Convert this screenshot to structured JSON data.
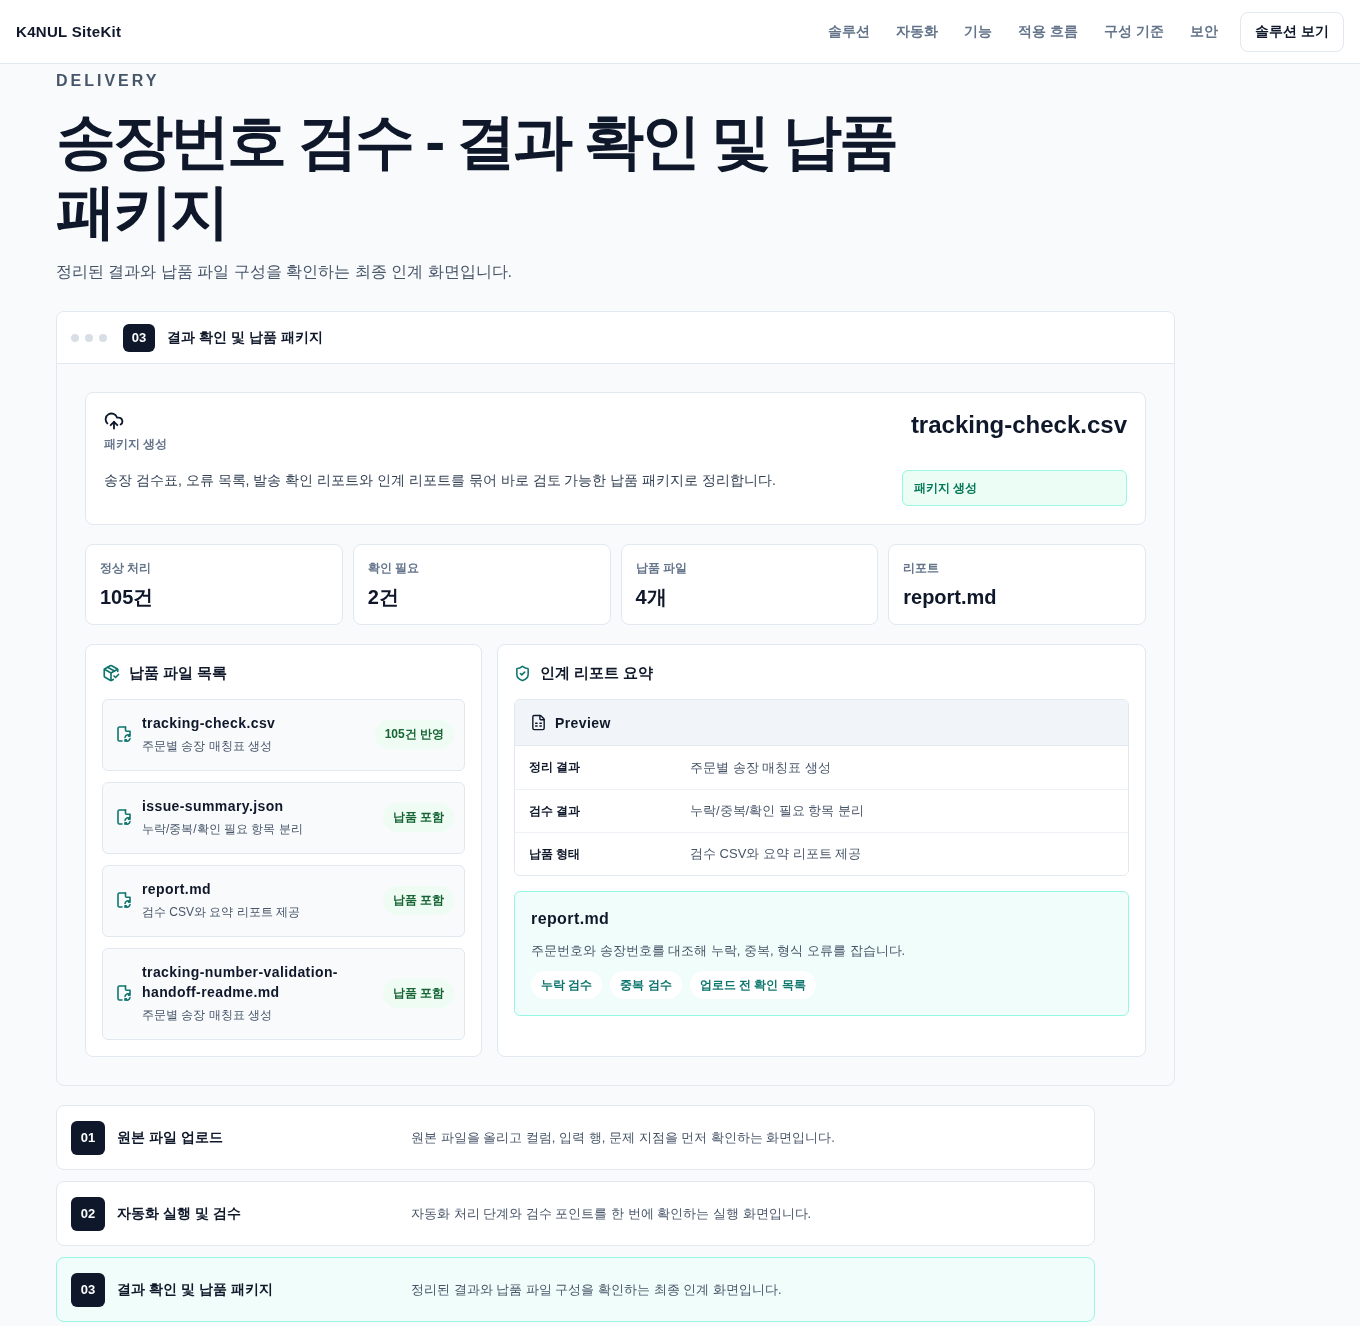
{
  "header": {
    "brand": "K4NUL SiteKit",
    "nav": [
      "솔루션",
      "자동화",
      "기능",
      "적용 흐름",
      "구성 기준",
      "보안"
    ],
    "cta": "솔루션 보기"
  },
  "intro": {
    "eyebrow": "DELIVERY",
    "title": "송장번호 검수 - 결과 확인 및 납품 패키지",
    "subtitle": "정리된 결과와 납품 파일 구성을 확인하는 최종 인계 화면입니다."
  },
  "panel": {
    "step": "03",
    "title": "결과 확인 및 납품 패키지",
    "package": {
      "label": "패키지 생성",
      "description": "송장 검수표, 오류 목록, 발송 확인 리포트와 인계 리포트를 묶어 바로 검토 가능한 납품 패키지로 정리합니다.",
      "file": "tracking-check.csv",
      "status": "패키지 생성"
    },
    "stats": [
      {
        "label": "정상 처리",
        "value": "105건"
      },
      {
        "label": "확인 필요",
        "value": "2건"
      },
      {
        "label": "납품 파일",
        "value": "4개"
      },
      {
        "label": "리포트",
        "value": "report.md"
      }
    ],
    "files": {
      "title": "납품 파일 목록",
      "items": [
        {
          "name": "tracking-check.csv",
          "description": "주문별 송장 매칭표 생성",
          "badge": "105건 반영"
        },
        {
          "name": "issue-summary.json",
          "description": "누락/중복/확인 필요 항목 분리",
          "badge": "납품 포함"
        },
        {
          "name": "report.md",
          "description": "검수 CSV와 요약 리포트 제공",
          "badge": "납품 포함"
        },
        {
          "name": "tracking-number-validation-handoff-readme.md",
          "description": "주문별 송장 매칭표 생성",
          "badge": "납품 포함"
        }
      ]
    },
    "report": {
      "title": "인계 리포트 요약",
      "preview": {
        "title": "Preview",
        "rows": [
          {
            "label": "정리 결과",
            "value": "주문별 송장 매칭표 생성"
          },
          {
            "label": "검수 결과",
            "value": "누락/중복/확인 필요 항목 분리"
          },
          {
            "label": "납품 형태",
            "value": "검수 CSV와 요약 리포트 제공"
          }
        ]
      },
      "note": {
        "file": "report.md",
        "description": "주문번호와 송장번호를 대조해 누락, 중복, 형식 오류를 잡습니다.",
        "tags": [
          "누락 검수",
          "중복 검수",
          "업로드 전 확인 목록"
        ]
      }
    }
  },
  "steps": [
    {
      "number": "01",
      "title": "원본 파일 업로드",
      "description": "원본 파일을 올리고 컬럼, 입력 행, 문제 지점을 먼저 확인하는 화면입니다.",
      "selected": false
    },
    {
      "number": "02",
      "title": "자동화 실행 및 검수",
      "description": "자동화 처리 단계와 검수 포인트를 한 번에 확인하는 실행 화면입니다.",
      "selected": false
    },
    {
      "number": "03",
      "title": "결과 확인 및 납품 패키지",
      "description": "정리된 결과와 납품 파일 구성을 확인하는 최종 인계 화면입니다.",
      "selected": true
    }
  ]
}
